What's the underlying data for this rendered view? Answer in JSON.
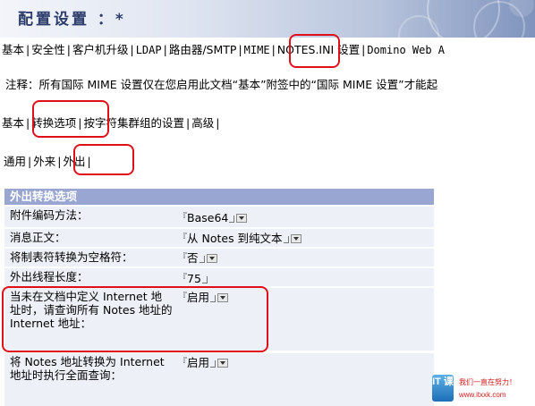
{
  "header": {
    "title": "配置设置 ：*"
  },
  "tabs_main": [
    {
      "label": "基本",
      "mono": false
    },
    {
      "label": "安全性",
      "mono": false
    },
    {
      "label": "客户机升级",
      "mono": false
    },
    {
      "label": "LDAP",
      "mono": true
    },
    {
      "label": "路由器/SMTP",
      "mono": false
    },
    {
      "label": "MIME",
      "mono": true
    },
    {
      "label": "NOTES.INI 设置",
      "mono": false
    },
    {
      "label": "Domino Web A",
      "mono": true
    }
  ],
  "note": "注释：所有国际 MIME 设置仅在您启用此文档“基本”附签中的“国际 MIME 设置”才能起",
  "tabs_sub": [
    "基本",
    "转换选项",
    "按字符集群组的设置",
    "高级"
  ],
  "tabs_dir": [
    "通用",
    "外来",
    "外出"
  ],
  "section": {
    "title": "外出转换选项",
    "rows": [
      {
        "label": "附件编码方法：",
        "value": "Base64"
      },
      {
        "label": "消息正文：",
        "value": "从 Notes 到纯文本"
      },
      {
        "label": "将制表符转换为空格符：",
        "value": "否"
      },
      {
        "label": "外出线程长度：",
        "value": "75"
      },
      {
        "label": "当未在文档中定义 Internet 地址时，请查询所有 Notes 地址的 Internet 地址：",
        "value": "启用"
      },
      {
        "label": "将 Notes 地址转换为 Internet 地址时执行全面查询：",
        "value": "启用"
      }
    ]
  },
  "watermark": {
    "logo_text": "IT 课",
    "slogan": "我们一直在努力！",
    "url": "www.itxxk.com"
  },
  "colors": {
    "accent": "#9aa6d2",
    "row_bg": "#eef0f8",
    "callout": "#e0101a",
    "header_title": "#2c3d6b"
  }
}
